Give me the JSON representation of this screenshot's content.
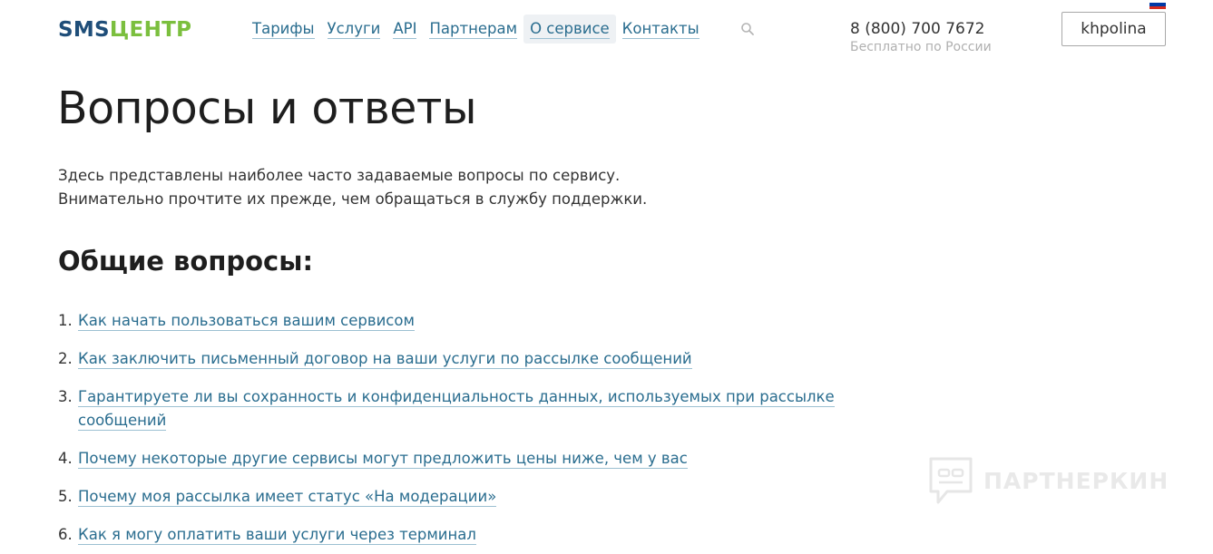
{
  "logo": {
    "part1": "SMS",
    "part2": "ЦЕНТР"
  },
  "nav": {
    "items": [
      {
        "label": "Тарифы",
        "active": false
      },
      {
        "label": "Услуги",
        "active": false
      },
      {
        "label": "API",
        "active": false
      },
      {
        "label": "Партнерам",
        "active": false
      },
      {
        "label": "О сервисе",
        "active": true
      },
      {
        "label": "Контакты",
        "active": false
      }
    ]
  },
  "header": {
    "search_icon": "search-icon",
    "phone": "8 (800) 700 7672",
    "phone_note": "Бесплатно по России",
    "login_label": "khpolina",
    "flag_colors": [
      "#ffffff",
      "#0039a6",
      "#d52b1e"
    ]
  },
  "main": {
    "title": "Вопросы и ответы",
    "intro_line1": "Здесь представлены наиболее часто задаваемые вопросы по сервису.",
    "intro_line2": "Внимательно прочтите их прежде, чем обращаться в службу поддержки.",
    "section_title": "Общие вопросы:",
    "faq": [
      {
        "num": "1.",
        "text": "Как начать пользоваться вашим сервисом"
      },
      {
        "num": "2.",
        "text": "Как заключить письменный договор на ваши услуги по рассылке сообщений"
      },
      {
        "num": "3.",
        "text": "Гарантируете ли вы сохранность и конфиденциальность данных, используемых при рассылке сообщений"
      },
      {
        "num": "4.",
        "text": "Почему некоторые другие сервисы могут предложить цены ниже, чем у вас"
      },
      {
        "num": "5.",
        "text": "Почему моя рассылка имеет статус «На модерации»"
      },
      {
        "num": "6.",
        "text": "Как я могу оплатить ваши услуги через терминал"
      }
    ]
  },
  "watermark": {
    "text": "ПАРТНЕРКИН"
  },
  "colors": {
    "link": "#2a6d8f",
    "logo_blue": "#1f4e79",
    "logo_green": "#7bbf3e"
  }
}
